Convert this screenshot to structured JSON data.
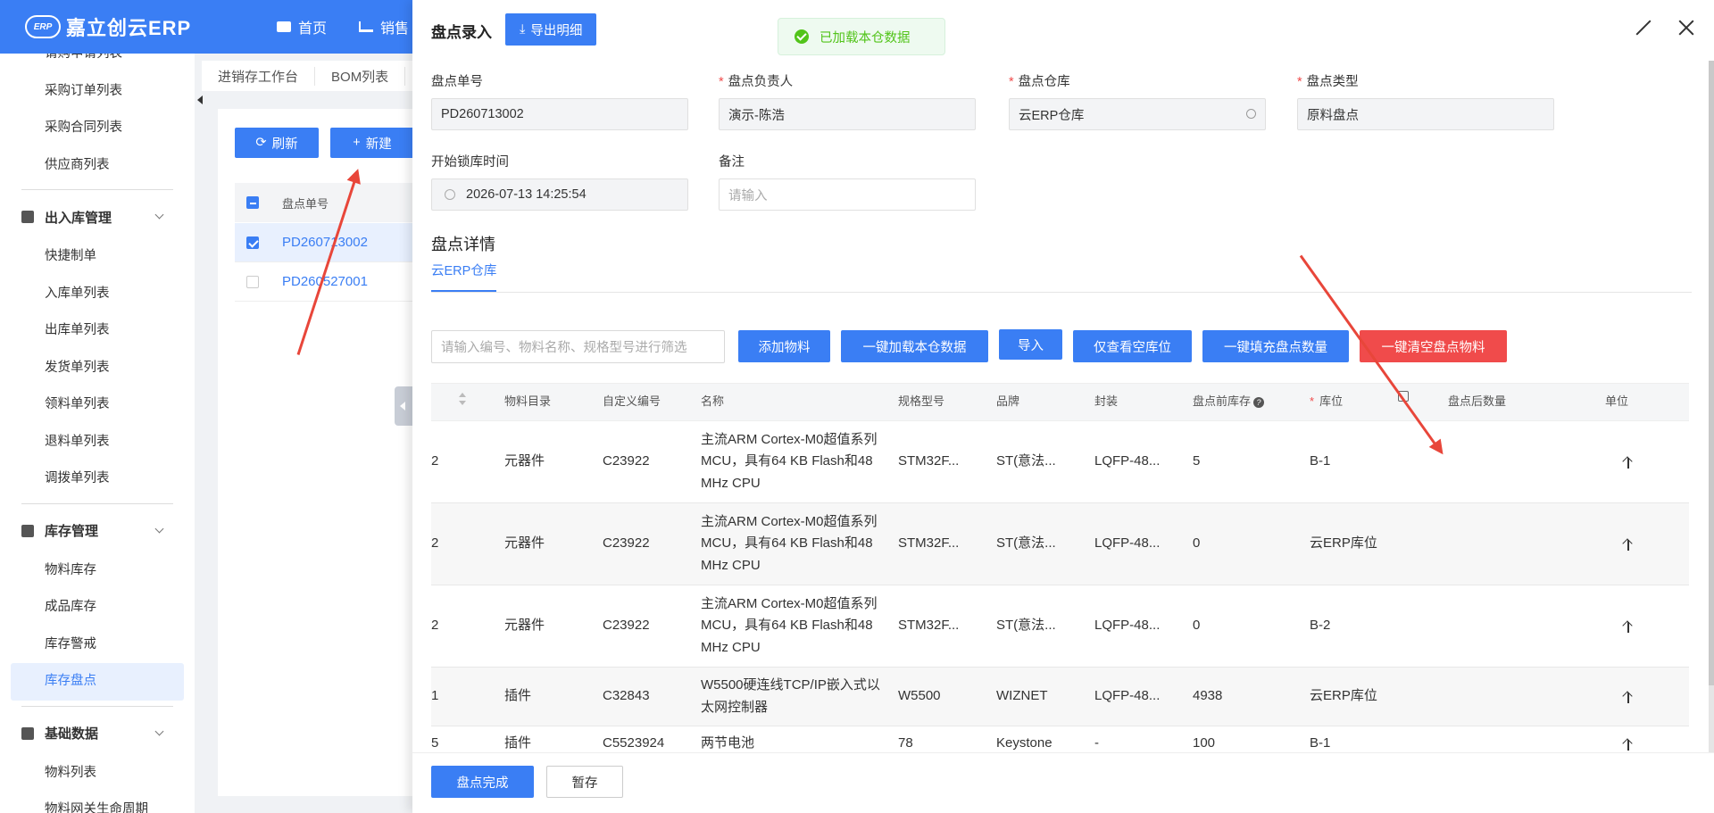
{
  "topbar": {
    "logo_badge": "ERP",
    "logo_text": "嘉立创云ERP",
    "nav": [
      "首页",
      "销售"
    ]
  },
  "sidebar": {
    "items_top": [
      "请购申请列表",
      "采购订单列表",
      "采购合同列表",
      "供应商列表"
    ],
    "groups": [
      {
        "label": "出入库管理",
        "items": [
          "快捷制单",
          "入库单列表",
          "出库单列表",
          "发货单列表",
          "领料单列表",
          "退料单列表",
          "调拨单列表"
        ]
      },
      {
        "label": "库存管理",
        "items": [
          "物料库存",
          "成品库存",
          "库存警戒",
          "库存盘点"
        ]
      },
      {
        "label": "基础数据",
        "items": [
          "物料列表",
          "物料网关生命周期"
        ]
      }
    ],
    "active_item": "库存盘点"
  },
  "background": {
    "tabs": [
      "进销存工作台",
      "BOM列表"
    ],
    "refresh_label": "刷新",
    "new_label": "新建",
    "col_header": "盘点单号",
    "rows": [
      "PD260713002",
      "PD260527001"
    ]
  },
  "toast": "已加载本仓数据",
  "drawer": {
    "title": "盘点录入",
    "export_label": "导出明细",
    "fields": {
      "no_label": "盘点单号",
      "no_value": "PD260713002",
      "owner_label": "盘点负责人",
      "owner_value": "演示-陈浩",
      "warehouse_label": "盘点仓库",
      "warehouse_value": "云ERP仓库",
      "type_label": "盘点类型",
      "type_value": "原料盘点",
      "lock_label": "开始锁库时间",
      "lock_value": "2026-07-13 14:25:54",
      "remark_label": "备注",
      "remark_placeholder": "请输入"
    },
    "detail_title": "盘点详情",
    "detail_tab": "云ERP仓库",
    "filter_placeholder": "请输入编号、物料名称、规格型号进行筛选",
    "actions": [
      "添加物料",
      "一键加载本仓数据",
      "导入",
      "仅查看空库位",
      "一键填充盘点数量",
      "一键清空盘点物料"
    ],
    "columns": [
      "物料目录",
      "自定义编号",
      "名称",
      "规格型号",
      "品牌",
      "封装",
      "盘点前库存",
      "库位",
      "盘点后数量",
      "单位"
    ],
    "rows": [
      {
        "idx": "2",
        "cat": "元器件",
        "code": "C23922",
        "name": "主流ARM Cortex-M0超值系列MCU，具有64 KB Flash和48 MHz CPU",
        "spec": "STM32F...",
        "brand": "ST(意法...",
        "pkg": "LQFP-48...",
        "before": "5",
        "loc": "B-1",
        "unit": "个"
      },
      {
        "idx": "2",
        "cat": "元器件",
        "code": "C23922",
        "name": "主流ARM Cortex-M0超值系列MCU，具有64 KB Flash和48 MHz CPU",
        "spec": "STM32F...",
        "brand": "ST(意法...",
        "pkg": "LQFP-48...",
        "before": "0",
        "loc": "云ERP库位",
        "unit": "个"
      },
      {
        "idx": "2",
        "cat": "元器件",
        "code": "C23922",
        "name": "主流ARM Cortex-M0超值系列MCU，具有64 KB Flash和48 MHz CPU",
        "spec": "STM32F...",
        "brand": "ST(意法...",
        "pkg": "LQFP-48...",
        "before": "0",
        "loc": "B-2",
        "unit": "个"
      },
      {
        "idx": "1",
        "cat": "插件",
        "code": "C32843",
        "name": "W5500硬连线TCP/IP嵌入式以太网控制器",
        "spec": "W5500",
        "brand": "WIZNET",
        "pkg": "LQFP-48...",
        "before": "4938",
        "loc": "云ERP库位",
        "unit": "个"
      },
      {
        "idx": "5",
        "cat": "插件",
        "code": "C5523924",
        "name": "两节电池",
        "spec": "78",
        "brand": "Keystone",
        "pkg": "-",
        "before": "100",
        "loc": "B-1",
        "unit": "个"
      }
    ],
    "complete_label": "盘点完成",
    "save_label": "暂存"
  },
  "colors": {
    "primary": "#3a7ef4",
    "danger": "#f04b4b",
    "annotation": "#e8463a",
    "success": "#52c41a"
  }
}
